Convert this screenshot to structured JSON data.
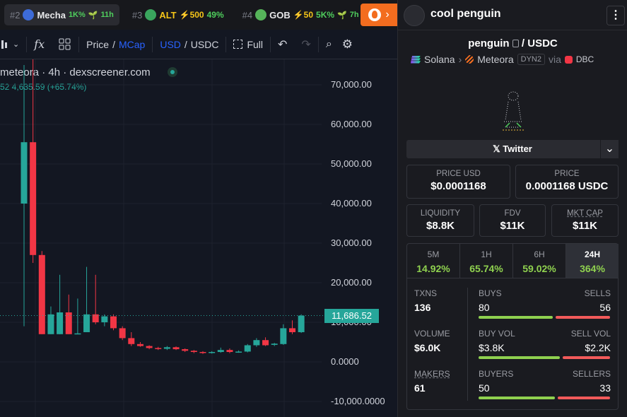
{
  "trending": {
    "items": [
      {
        "rank": "#2",
        "name": "Mecha",
        "stat1": "1K%",
        "stat2": "11h",
        "icon_color": "#3d6bd8"
      },
      {
        "rank": "#3",
        "name": "ALT",
        "stat1": "⚡500",
        "stat2": "49%",
        "icon_color": "#3aa55d"
      },
      {
        "rank": "#4",
        "name": "GOB",
        "stat1": "⚡50",
        "stat2": "5K%",
        "stat3": "7h",
        "icon_color": "#56b35a"
      }
    ]
  },
  "toolbar": {
    "price_label": "Price",
    "mcap_label": "MCap",
    "usd_label": "USD",
    "usdc_label": "USDC",
    "full_label": "Full"
  },
  "chart": {
    "title": "meteora · 4h · dexscreener.com",
    "subtitle": "52  4,635.59 (+65.74%)",
    "current_price_label": "11,686.52",
    "current_price_color": "#26a69a",
    "up_color": "#26a69a",
    "down_color": "#f23645"
  },
  "chart_data": {
    "type": "candlestick",
    "y_ticks": [
      "70,000.00",
      "60,000.00",
      "50,000.00",
      "40,000.00",
      "30,000.00",
      "20,000.00",
      "10,000.00",
      "0.0000",
      "-10,000.0000"
    ],
    "ylim": [
      -10000,
      70000
    ],
    "candles": [
      {
        "o": 40000,
        "c": 55500,
        "h": 75000,
        "l": 9000
      },
      {
        "o": 55500,
        "c": 27000,
        "h": 80000,
        "l": 25000
      },
      {
        "o": 27000,
        "c": 7000,
        "h": 28000,
        "l": 7000
      },
      {
        "o": 7000,
        "c": 12000,
        "h": 14000,
        "l": 7000
      },
      {
        "o": 7000,
        "c": 12500,
        "h": 22000,
        "l": 7000
      },
      {
        "o": 12500,
        "c": 7000,
        "h": 17000,
        "l": 7000
      },
      {
        "o": 7000,
        "c": 7200,
        "h": 16000,
        "l": 7000
      },
      {
        "o": 7500,
        "c": 12000,
        "h": 24000,
        "l": 7500
      },
      {
        "o": 12000,
        "c": 10000,
        "h": 22000,
        "l": 9500
      },
      {
        "o": 10000,
        "c": 11500,
        "h": 12000,
        "l": 9000
      },
      {
        "o": 11500,
        "c": 8500,
        "h": 12000,
        "l": 8000
      },
      {
        "o": 8500,
        "c": 6000,
        "h": 9000,
        "l": 5500
      },
      {
        "o": 6000,
        "c": 4500,
        "h": 7500,
        "l": 4000
      },
      {
        "o": 4500,
        "c": 4000,
        "h": 5000,
        "l": 3800
      },
      {
        "o": 4000,
        "c": 3500,
        "h": 4200,
        "l": 3200
      },
      {
        "o": 3500,
        "c": 3300,
        "h": 3800,
        "l": 3000
      },
      {
        "o": 3300,
        "c": 3700,
        "h": 4000,
        "l": 3000
      },
      {
        "o": 3700,
        "c": 3200,
        "h": 3900,
        "l": 3000
      },
      {
        "o": 3200,
        "c": 2800,
        "h": 3400,
        "l": 2500
      },
      {
        "o": 2800,
        "c": 2500,
        "h": 3000,
        "l": 2200
      },
      {
        "o": 2500,
        "c": 2300,
        "h": 2700,
        "l": 2000
      },
      {
        "o": 2300,
        "c": 2500,
        "h": 2700,
        "l": 2100
      },
      {
        "o": 2500,
        "c": 3000,
        "h": 3600,
        "l": 2300
      },
      {
        "o": 3000,
        "c": 2500,
        "h": 3400,
        "l": 2200
      },
      {
        "o": 2500,
        "c": 2600,
        "h": 2900,
        "l": 2300
      },
      {
        "o": 2600,
        "c": 4200,
        "h": 4500,
        "l": 2400
      },
      {
        "o": 4200,
        "c": 5500,
        "h": 6000,
        "l": 3800
      },
      {
        "o": 5500,
        "c": 4200,
        "h": 6200,
        "l": 4000
      },
      {
        "o": 4300,
        "c": 4600,
        "h": 4800,
        "l": 4000
      },
      {
        "o": 4500,
        "c": 8500,
        "h": 9500,
        "l": 4300
      },
      {
        "o": 8500,
        "c": 7500,
        "h": 10500,
        "l": 7000
      },
      {
        "o": 7500,
        "c": 11686,
        "h": 12000,
        "l": 7300
      }
    ]
  },
  "panel": {
    "token_name": "cool penguin",
    "pair_base": "penguin",
    "pair_quote": "USDC",
    "chain": "Solana",
    "dex": "Meteora",
    "dex_tag": "DYN2",
    "via_label": "via",
    "via_name": "DBC",
    "twitter_label": "Twitter",
    "price_usd_label": "PRICE USD",
    "price_usd": "$0.0001168",
    "price_label": "PRICE",
    "price": "0.0001168 USDC",
    "liquidity_label": "LIQUIDITY",
    "liquidity": "$8.8K",
    "fdv_label": "FDV",
    "fdv": "$11K",
    "mcap_label": "MKT CAP",
    "mcap": "$11K",
    "tabs": [
      {
        "label": "5M",
        "pct": "14.92%"
      },
      {
        "label": "1H",
        "pct": "65.74%"
      },
      {
        "label": "6H",
        "pct": "59.02%"
      },
      {
        "label": "24H",
        "pct": "364%"
      }
    ],
    "txns_label": "TXNS",
    "txns": "136",
    "buys_label": "BUYS",
    "buys": "80",
    "sells_label": "SELLS",
    "sells": "56",
    "volume_label": "VOLUME",
    "volume": "$6.0K",
    "buyvol_label": "BUY VOL",
    "buyvol": "$3.8K",
    "sellvol_label": "SELL VOL",
    "sellvol": "$2.2K",
    "makers_label": "MAKERS",
    "makers": "61",
    "buyers_label": "BUYERS",
    "buyers": "50",
    "sellers_label": "SELLERS",
    "sellers": "33"
  }
}
